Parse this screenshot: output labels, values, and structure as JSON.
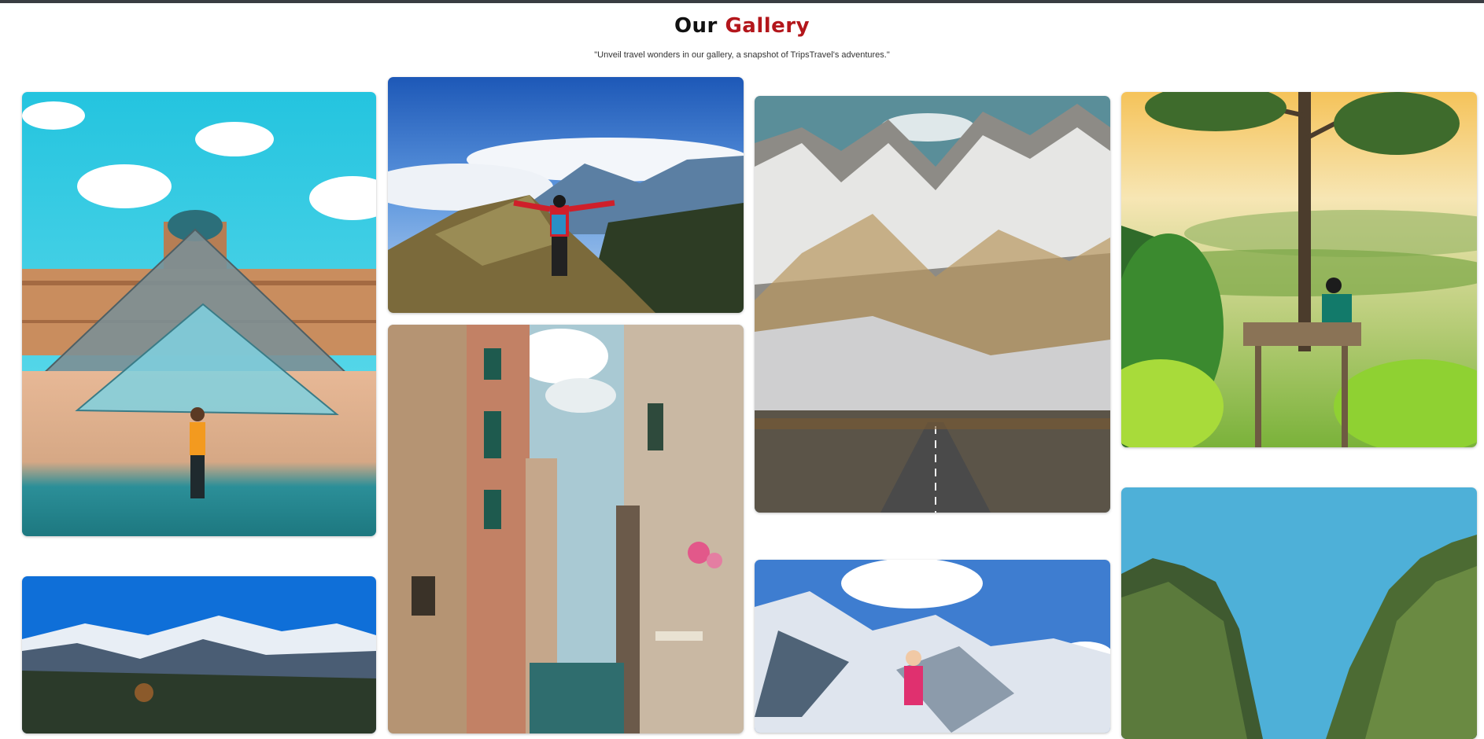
{
  "header": {
    "title_part1": "Our",
    "title_part2": "Gallery",
    "subtitle": "\"Unveil travel wonders in our gallery, a snapshot of TripsTravel's adventures.\""
  },
  "colors": {
    "title_dark": "#111111",
    "title_accent": "#b3161b",
    "top_bar": "#3a3d42"
  },
  "gallery": {
    "images": [
      "louvre-pyramid-photo",
      "mountain-summit-hiker-photo",
      "snowy-mountain-range-road-photo",
      "treehouse-valley-view-photo",
      "alpine-lake-mountains-photo",
      "venice-canal-buildings-photo",
      "snow-mountain-hiker-photo",
      "limestone-cliffs-photo"
    ]
  }
}
